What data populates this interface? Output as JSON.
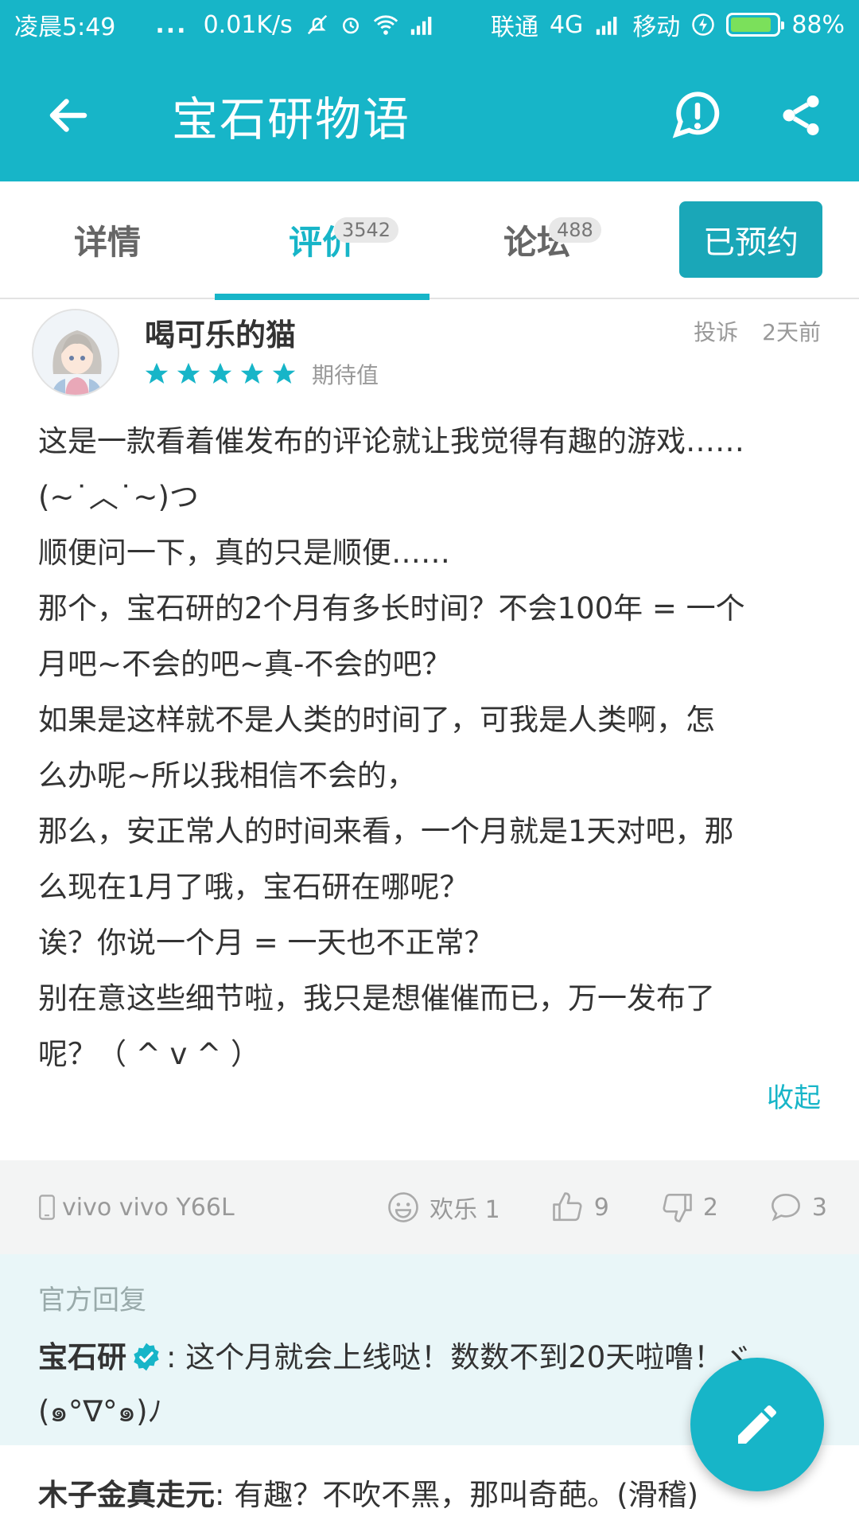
{
  "status_bar": {
    "time": "凌晨5:49",
    "dots": "...",
    "speed": "0.01K/s",
    "carrier1": "联通",
    "network": "4G",
    "carrier2": "移动",
    "battery": "88%"
  },
  "app_bar": {
    "title": "宝石研物语",
    "back_icon": "arrow-left-icon",
    "report_icon": "exclamation-icon",
    "share_icon": "share-icon"
  },
  "tabs": [
    {
      "label": "详情"
    },
    {
      "label": "评价",
      "count": "3542"
    },
    {
      "label": "论坛",
      "count": "488"
    }
  ],
  "reserve_button": "已预约",
  "review": {
    "username": "喝可乐的猫",
    "rating_stars": 5,
    "rating_label": "期待值",
    "report": "投诉",
    "time": "2天前",
    "body_lines": [
      "这是一款看着催发布的评论就让我觉得有趣的游戏……",
      "(~˙︿˙~)つ",
      "顺便问一下，真的只是顺便……",
      "那个，宝石研的2个月有多长时间？不会100年 = 一个",
      "月吧~不会的吧~真-不会的吧？",
      "如果是这样就不是人类的时间了，可我是人类啊，怎",
      "么办呢~所以我相信不会的，",
      "那么，安正常人的时间来看，一个月就是1天对吧，那",
      "么现在1月了哦，宝石研在哪呢？",
      "诶？你说一个月 = 一天也不正常？",
      "别在意这些细节啦，我只是想催催而已，万一发布了",
      "呢？（ ^ v ^ ）"
    ],
    "collapse": "收起",
    "device": "vivo vivo Y66L",
    "fun_label": "欢乐 1",
    "likes": "9",
    "dislikes": "2",
    "comments": "3"
  },
  "official_reply": {
    "label": "官方回复",
    "author": "宝石研",
    "text_line1": ": 这个月就会上线哒！数数不到20天啦噜！ヾ",
    "text_line2": "(๑°∇°๑)ﾉ"
  },
  "next_comment": {
    "author": "木子金真走元",
    "text": ": 有趣？不吹不黑，那叫奇葩。(滑稽)"
  },
  "colors": {
    "primary": "#17b5c8",
    "reserve": "#1aa7b8",
    "reply_bg": "#e9f6f8",
    "action_bg": "#f3f4f4"
  },
  "fab_icon": "pencil-icon"
}
